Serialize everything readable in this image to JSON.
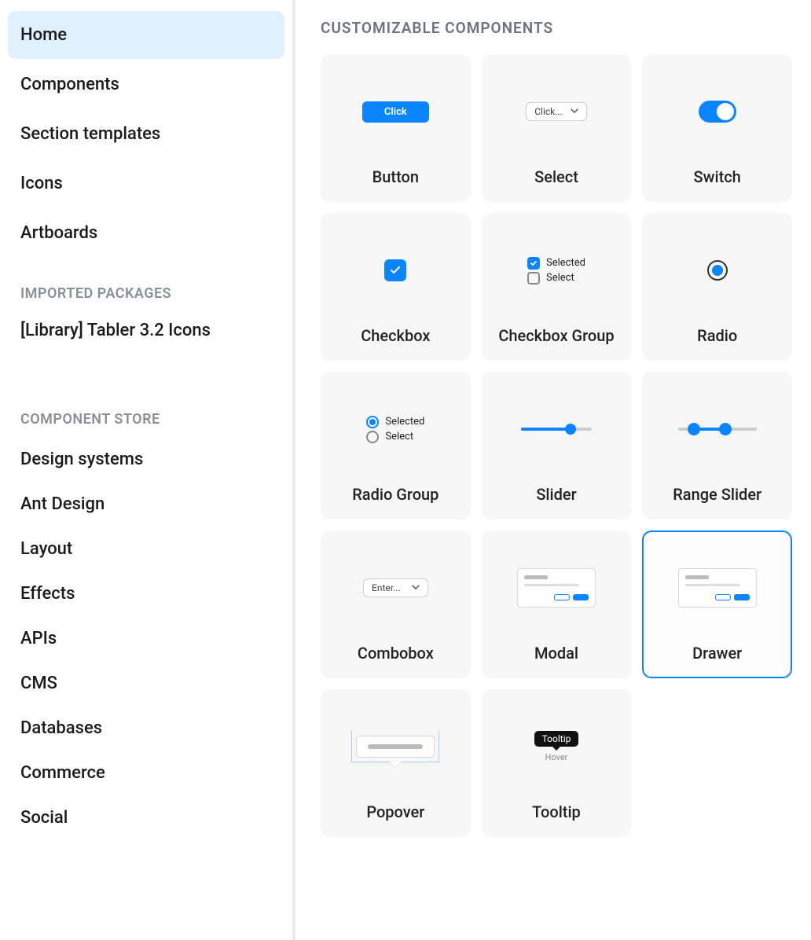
{
  "sidebar": {
    "nav": [
      {
        "label": "Home",
        "active": true
      },
      {
        "label": "Components",
        "active": false
      },
      {
        "label": "Section templates",
        "active": false
      },
      {
        "label": "Icons",
        "active": false
      },
      {
        "label": "Artboards",
        "active": false
      }
    ],
    "packages_heading": "IMPORTED PACKAGES",
    "packages": [
      {
        "label": "[Library] Tabler 3.2 Icons"
      }
    ],
    "store_heading": "COMPONENT STORE",
    "store": [
      {
        "label": "Design systems"
      },
      {
        "label": "Ant Design"
      },
      {
        "label": "Layout"
      },
      {
        "label": "Effects"
      },
      {
        "label": "APIs"
      },
      {
        "label": "CMS"
      },
      {
        "label": "Databases"
      },
      {
        "label": "Commerce"
      },
      {
        "label": "Social"
      }
    ]
  },
  "main": {
    "heading": "CUSTOMIZABLE COMPONENTS",
    "preview_text": {
      "button": "Click",
      "select": "Click...",
      "checkbox_selected": "Selected",
      "checkbox_unselected": "Select",
      "radio_selected": "Selected",
      "radio_unselected": "Select",
      "combo": "Enter...",
      "tooltip": "Tooltip",
      "tooltip_hover": "Hover"
    },
    "cards": [
      {
        "label": "Button",
        "selected": false
      },
      {
        "label": "Select",
        "selected": false
      },
      {
        "label": "Switch",
        "selected": false
      },
      {
        "label": "Checkbox",
        "selected": false
      },
      {
        "label": "Checkbox Group",
        "selected": false
      },
      {
        "label": "Radio",
        "selected": false
      },
      {
        "label": "Radio Group",
        "selected": false
      },
      {
        "label": "Slider",
        "selected": false
      },
      {
        "label": "Range Slider",
        "selected": false
      },
      {
        "label": "Combobox",
        "selected": false
      },
      {
        "label": "Modal",
        "selected": false
      },
      {
        "label": "Drawer",
        "selected": true
      },
      {
        "label": "Popover",
        "selected": false
      },
      {
        "label": "Tooltip",
        "selected": false
      }
    ]
  },
  "colors": {
    "accent": "#0a84ff"
  }
}
